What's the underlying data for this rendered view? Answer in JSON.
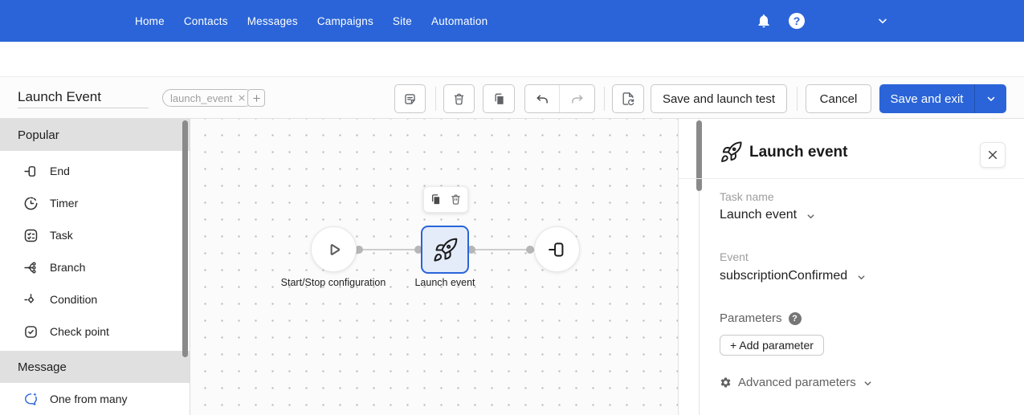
{
  "nav": {
    "items": [
      "Home",
      "Contacts",
      "Messages",
      "Campaigns",
      "Site",
      "Automation"
    ],
    "icons": [
      "bell-icon",
      "help-icon",
      "chevron-down-icon"
    ]
  },
  "toolbar": {
    "workflow_title": "Launch Event",
    "tag": {
      "label": "launch_event"
    },
    "tools": [
      {
        "icon": "comment-note-icon"
      },
      {
        "icon": "trash-icon"
      },
      {
        "icon": "copy-icon"
      },
      {
        "icon": "undo-icon"
      },
      {
        "icon": "redo-icon"
      },
      {
        "icon": "document-restart-icon"
      }
    ],
    "actions": {
      "save_and_launch_test": "Save and launch test",
      "cancel": "Cancel",
      "save_and_exit": "Save and exit"
    }
  },
  "sidebar": {
    "sections": [
      {
        "label": "Popular",
        "items": [
          {
            "label": "End",
            "icon": "end-icon"
          },
          {
            "label": "Timer",
            "icon": "timer-icon"
          },
          {
            "label": "Task",
            "icon": "task-icon"
          },
          {
            "label": "Branch",
            "icon": "branch-icon"
          },
          {
            "label": "Condition",
            "icon": "condition-icon"
          },
          {
            "label": "Check point",
            "icon": "checkpoint-icon"
          }
        ]
      },
      {
        "label": "Message",
        "items": [
          {
            "label": "One from many",
            "icon": "one-from-many-icon"
          }
        ]
      }
    ]
  },
  "canvas": {
    "nodes": {
      "start": {
        "label": "Start/Stop configuration",
        "icon": "play-icon"
      },
      "launch": {
        "label": "Launch event",
        "icon": "rocket-icon",
        "selected": true
      },
      "end": {
        "icon": "end-icon"
      }
    },
    "node_toolbar_icons": [
      "copy-icon",
      "trash-icon"
    ]
  },
  "panel": {
    "title": "Launch event",
    "title_icon": "rocket-icon",
    "task_name": {
      "label": "Task name",
      "value": "Launch event"
    },
    "event": {
      "label": "Event",
      "value": "subscriptionConfirmed"
    },
    "parameters": {
      "label": "Parameters",
      "help_icon": "question-circle-icon",
      "add_button_label": "+ Add parameter"
    },
    "advanced": {
      "label": "Advanced parameters",
      "icon": "gear-icon"
    }
  },
  "colors": {
    "primary_blue": "#2a64d8",
    "selected_node_fill": "#e4ecfa",
    "section_header_bg": "#e0e0e0",
    "canvas_dot": "#b9b9b9"
  }
}
